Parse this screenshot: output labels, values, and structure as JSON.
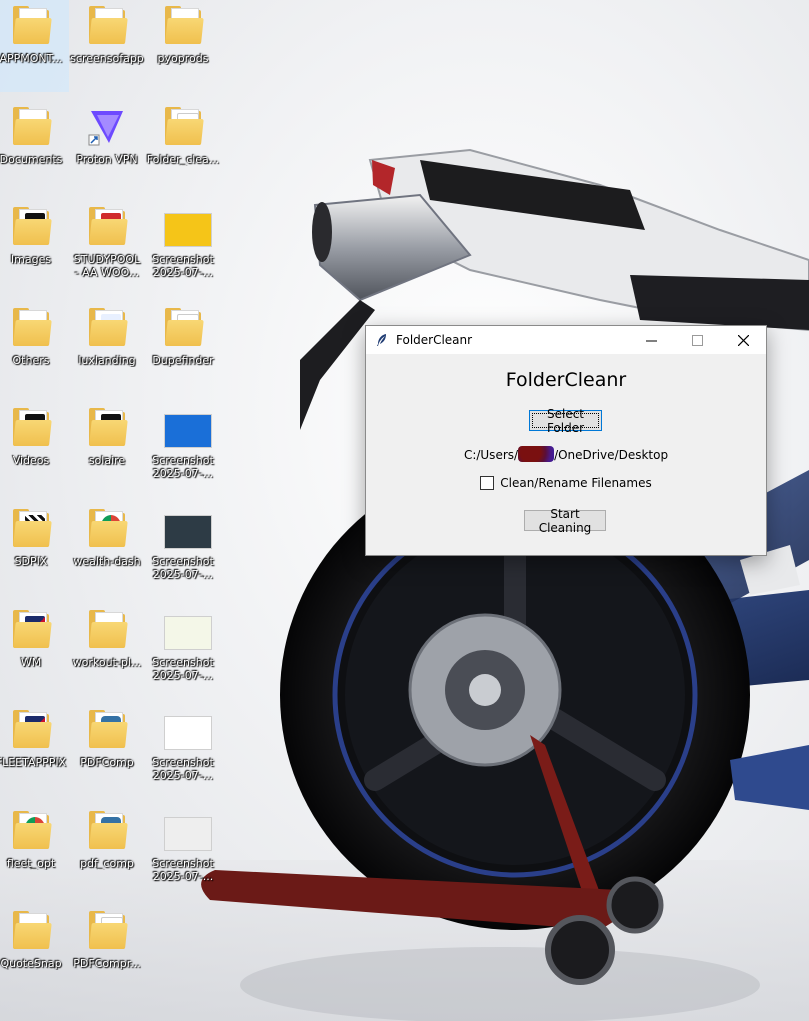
{
  "desktop": {
    "icons": [
      {
        "label": "APPMONT...",
        "type": "folder",
        "badge": "",
        "selected": true
      },
      {
        "label": "screensofapp",
        "type": "folder",
        "badge": "",
        "selected": false
      },
      {
        "label": "pyoprods",
        "type": "folder",
        "badge": "",
        "selected": false
      },
      {
        "label": "Documents",
        "type": "folder",
        "badge": "",
        "selected": false
      },
      {
        "label": "Proton VPN",
        "type": "app",
        "badge": "",
        "selected": false
      },
      {
        "label": "Folder_clea...",
        "type": "folder",
        "badge": "shield",
        "selected": false
      },
      {
        "label": "Images",
        "type": "folder",
        "badge": "dark",
        "selected": false
      },
      {
        "label": "STUDYPOOL\n- AA WOO...",
        "type": "folder",
        "badge": "pdf",
        "selected": false
      },
      {
        "label": "Screenshot\n2025-07-...",
        "type": "screenshot",
        "badge": "yellow",
        "selected": false
      },
      {
        "label": "Others",
        "type": "folder",
        "badge": "",
        "selected": false
      },
      {
        "label": "luxlanding",
        "type": "folder",
        "badge": "hash",
        "selected": false
      },
      {
        "label": "Dupefinder",
        "type": "folder",
        "badge": "shield",
        "selected": false
      },
      {
        "label": "Videos",
        "type": "folder",
        "badge": "dark",
        "selected": false
      },
      {
        "label": "solaire",
        "type": "folder",
        "badge": "dark",
        "selected": false
      },
      {
        "label": "Screenshot\n2025-07-...",
        "type": "screenshot",
        "badge": "blue",
        "selected": false
      },
      {
        "label": "SDPIX",
        "type": "folder",
        "badge": "pattern",
        "selected": false
      },
      {
        "label": "wealth-dash",
        "type": "folder",
        "badge": "chrome",
        "selected": false
      },
      {
        "label": "Screenshot\n2025-07-...",
        "type": "screenshot",
        "badge": "teal",
        "selected": false
      },
      {
        "label": "WM",
        "type": "folder",
        "badge": "flag",
        "selected": false
      },
      {
        "label": "workout-pl...",
        "type": "folder",
        "badge": "",
        "selected": false
      },
      {
        "label": "Screenshot\n2025-07-...",
        "type": "screenshot",
        "badge": "green",
        "selected": false
      },
      {
        "label": "FLEETAPPPIX",
        "type": "folder",
        "badge": "flag",
        "selected": false
      },
      {
        "label": "PDFComp",
        "type": "folder",
        "badge": "python",
        "selected": false
      },
      {
        "label": "Screenshot\n2025-07-...",
        "type": "screenshot",
        "badge": "red",
        "selected": false
      },
      {
        "label": "fleet_opt",
        "type": "folder",
        "badge": "chrome",
        "selected": false
      },
      {
        "label": "pdf_comp",
        "type": "folder",
        "badge": "python",
        "selected": false
      },
      {
        "label": "Screenshot\n2025-07-...",
        "type": "screenshot",
        "badge": "gray",
        "selected": false
      },
      {
        "label": "QuoteSnap",
        "type": "folder",
        "badge": "",
        "selected": false
      },
      {
        "label": "PDFCompr...",
        "type": "folder",
        "badge": "shield",
        "selected": false
      }
    ]
  },
  "window": {
    "title": "FolderCleanr",
    "heading": "FolderCleanr",
    "select_button_label": "Select Folder",
    "path_prefix": "C:/Users/",
    "path_suffix": "/OneDrive/Desktop",
    "checkbox_label": "Clean/Rename Filenames",
    "checkbox_checked": false,
    "start_button_label": "Start Cleaning",
    "controls": {
      "minimize": "─",
      "maximize": "☐",
      "close": "✕"
    }
  },
  "colors": {
    "folder": "#f0c04e",
    "accent": "#0078d7"
  }
}
